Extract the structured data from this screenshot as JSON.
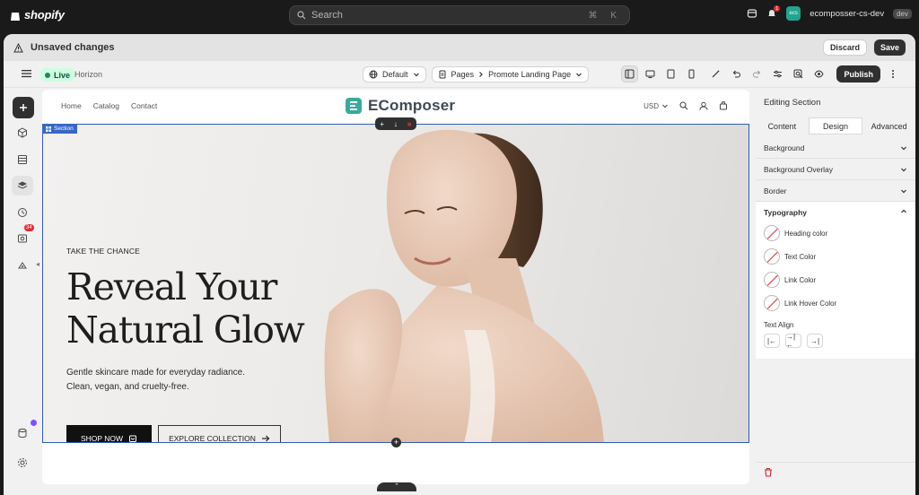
{
  "topbar": {
    "brand": "shopify",
    "search_placeholder": "Search",
    "shortcut": "⌘ K",
    "notification_count": "1",
    "store_initials": "ecs",
    "store_name": "ecomposser-cs-dev",
    "store_tag": "dev"
  },
  "unsaved": {
    "label": "Unsaved changes",
    "discard": "Discard",
    "save": "Save"
  },
  "editor": {
    "status": "Live",
    "theme": "Horizon",
    "locale": "Default",
    "pages_label": "Pages",
    "page_name": "Promote Landing Page",
    "publish": "Publish"
  },
  "rail": {
    "badge_count": "34"
  },
  "site": {
    "nav": [
      "Home",
      "Catalog",
      "Contact"
    ],
    "brand": "EComposer",
    "currency": "USD",
    "section_tag": "Section"
  },
  "hero": {
    "eyebrow": "TAKE THE CHANCE",
    "headline_line1": "Reveal Your",
    "headline_line2": "Natural Glow",
    "sub_line1": "Gentle skincare made for everyday radiance.",
    "sub_line2": "Clean, vegan, and cruelty-free.",
    "cta_primary": "SHOP NOW",
    "cta_secondary": "EXPLORE COLLECTION"
  },
  "panel": {
    "title": "Editing Section",
    "tabs": [
      "Content",
      "Design",
      "Advanced"
    ],
    "active_tab": "Design",
    "sections": [
      "Background",
      "Background Overlay",
      "Border"
    ],
    "typography": {
      "title": "Typography",
      "colors": [
        "Heading color",
        "Text Color",
        "Link Color",
        "Link Hover Color"
      ],
      "text_align_label": "Text Align"
    }
  },
  "colors": {
    "accent_selection": "#2d5bb5",
    "live_green": "#29845a",
    "danger": "#e22c38"
  }
}
